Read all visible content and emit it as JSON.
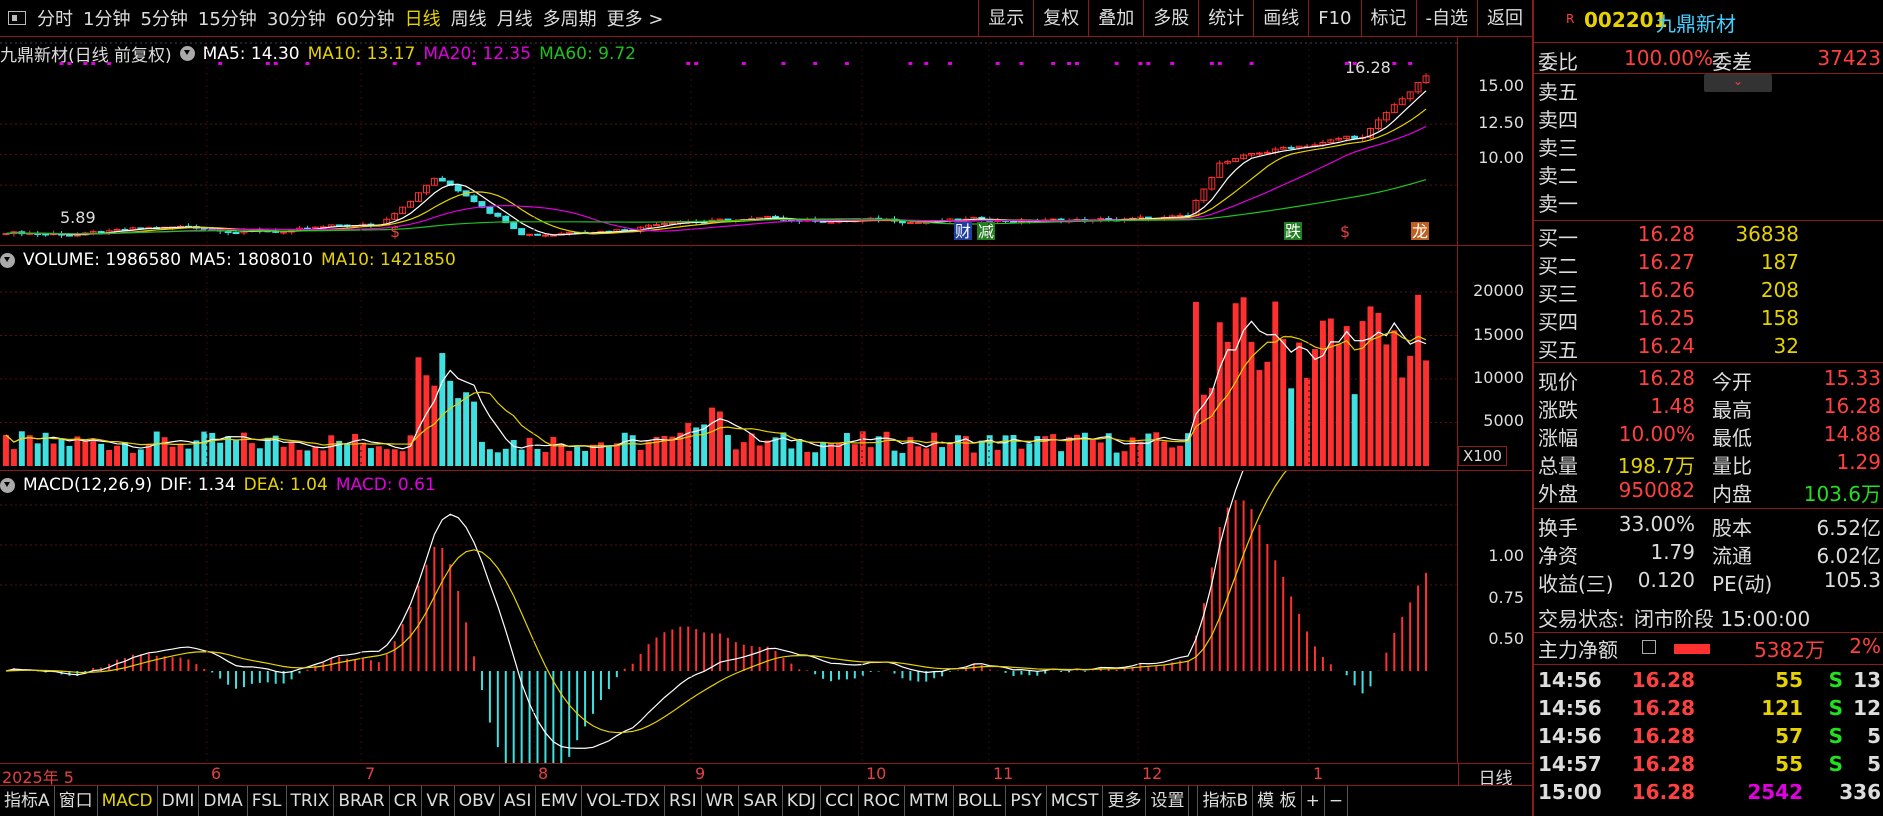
{
  "topbar": {
    "items": [
      "分时",
      "1分钟",
      "5分钟",
      "15分钟",
      "30分钟",
      "60分钟",
      "日线",
      "周线",
      "月线",
      "多周期",
      "更多 >"
    ],
    "active": "日线",
    "right": [
      "显示",
      "复权",
      "叠加",
      "多股",
      "统计",
      "画线",
      "F10",
      "标记",
      "-自选",
      "返回"
    ]
  },
  "kline": {
    "title": "九鼎新材(日线 前复权)",
    "ma5": "MA5: 14.30",
    "ma10": "MA10: 13.17",
    "ma20": "MA20: 12.35",
    "ma60": "MA60: 9.72",
    "high_label": "16.28",
    "low_label": "5.89",
    "yaxis": [
      "15.00",
      "12.50",
      "10.00"
    ],
    "markers": [
      {
        "t": "$",
        "c": "#e04040"
      },
      {
        "t": "财",
        "c": "#ffffff",
        "bg": "#2040a0"
      },
      {
        "t": "减",
        "c": "#ffffff",
        "bg": "#208020"
      },
      {
        "t": "跌",
        "c": "#ffffff",
        "bg": "#208020"
      },
      {
        "t": "$",
        "c": "#e04040"
      },
      {
        "t": "龙",
        "c": "#ffffff",
        "bg": "#c06020"
      }
    ]
  },
  "volume": {
    "title": "VOLUME: 1986580",
    "ma5": "MA5: 1808010",
    "ma10": "MA10: 1421850",
    "yaxis": [
      "20000",
      "15000",
      "10000",
      "5000"
    ],
    "unit": "X100"
  },
  "macd": {
    "title": "MACD(12,26,9)",
    "dif": "DIF: 1.34",
    "dea": "DEA: 1.04",
    "macd": "MACD: 0.61",
    "yaxis": [
      "1.00",
      "0.75",
      "0.50"
    ]
  },
  "months": [
    "2025年 5",
    "6",
    "7",
    "8",
    "9",
    "10",
    "11",
    "12",
    "1"
  ],
  "period_label": "日线",
  "bottombar": [
    "指标A",
    "窗口",
    "MACD",
    "DMI",
    "DMA",
    "FSL",
    "TRIX",
    "BRAR",
    "CR",
    "VR",
    "OBV",
    "ASI",
    "EMV",
    "VOL-TDX",
    "RSI",
    "WR",
    "SAR",
    "KDJ",
    "CCI",
    "ROC",
    "MTM",
    "BOLL",
    "PSY",
    "MCST",
    "更多",
    "设置",
    "",
    "指标B",
    "模 板",
    "+",
    "−"
  ],
  "bottom_active": "MACD",
  "quote": {
    "badge": "R",
    "code": "002201",
    "name": "九鼎新材",
    "weibi_label": "委比",
    "weibi": "100.00%",
    "weicha_label": "委差",
    "weicha": "37423",
    "asks": [
      "卖五",
      "卖四",
      "卖三",
      "卖二",
      "卖一"
    ],
    "bids": [
      {
        "l": "买一",
        "p": "16.28",
        "v": "36838"
      },
      {
        "l": "买二",
        "p": "16.27",
        "v": "187"
      },
      {
        "l": "买三",
        "p": "16.26",
        "v": "208"
      },
      {
        "l": "买四",
        "p": "16.25",
        "v": "158"
      },
      {
        "l": "买五",
        "p": "16.24",
        "v": "32"
      }
    ],
    "stats": [
      [
        "现价",
        "16.28",
        "今开",
        "15.33"
      ],
      [
        "涨跌",
        "1.48",
        "最高",
        "16.28"
      ],
      [
        "涨幅",
        "10.00%",
        "最低",
        "14.88"
      ],
      [
        "总量",
        "198.7万",
        "量比",
        "1.29"
      ],
      [
        "外盘",
        "950082",
        "内盘",
        "103.6万"
      ],
      [
        "换手",
        "33.00%",
        "股本",
        "6.52亿"
      ],
      [
        "净资",
        "1.79",
        "流通",
        "6.02亿"
      ],
      [
        "收益(三)",
        "0.120",
        "PE(动)",
        "105.3"
      ]
    ],
    "status_label": "交易状态:",
    "status": "闭市阶段 15:00:00",
    "mainflow_label": "主力净额",
    "mainflow": "5382万",
    "mainflow_pct": "2%",
    "ticks": [
      [
        "14:56",
        "16.28",
        "55",
        "S",
        "13"
      ],
      [
        "14:56",
        "16.28",
        "121",
        "S",
        "12"
      ],
      [
        "14:56",
        "16.28",
        "57",
        "S",
        "5"
      ],
      [
        "14:57",
        "16.28",
        "55",
        "S",
        "5"
      ],
      [
        "15:00",
        "16.28",
        "2542",
        "",
        "336"
      ]
    ]
  },
  "colors": {
    "up": "#ff3030",
    "down": "#40e0e0",
    "ma5": "#ffffff",
    "ma10": "#e5d200",
    "ma20": "#e000e0",
    "ma60": "#20c020",
    "dea": "#e5d200",
    "dif": "#ffffff"
  }
}
